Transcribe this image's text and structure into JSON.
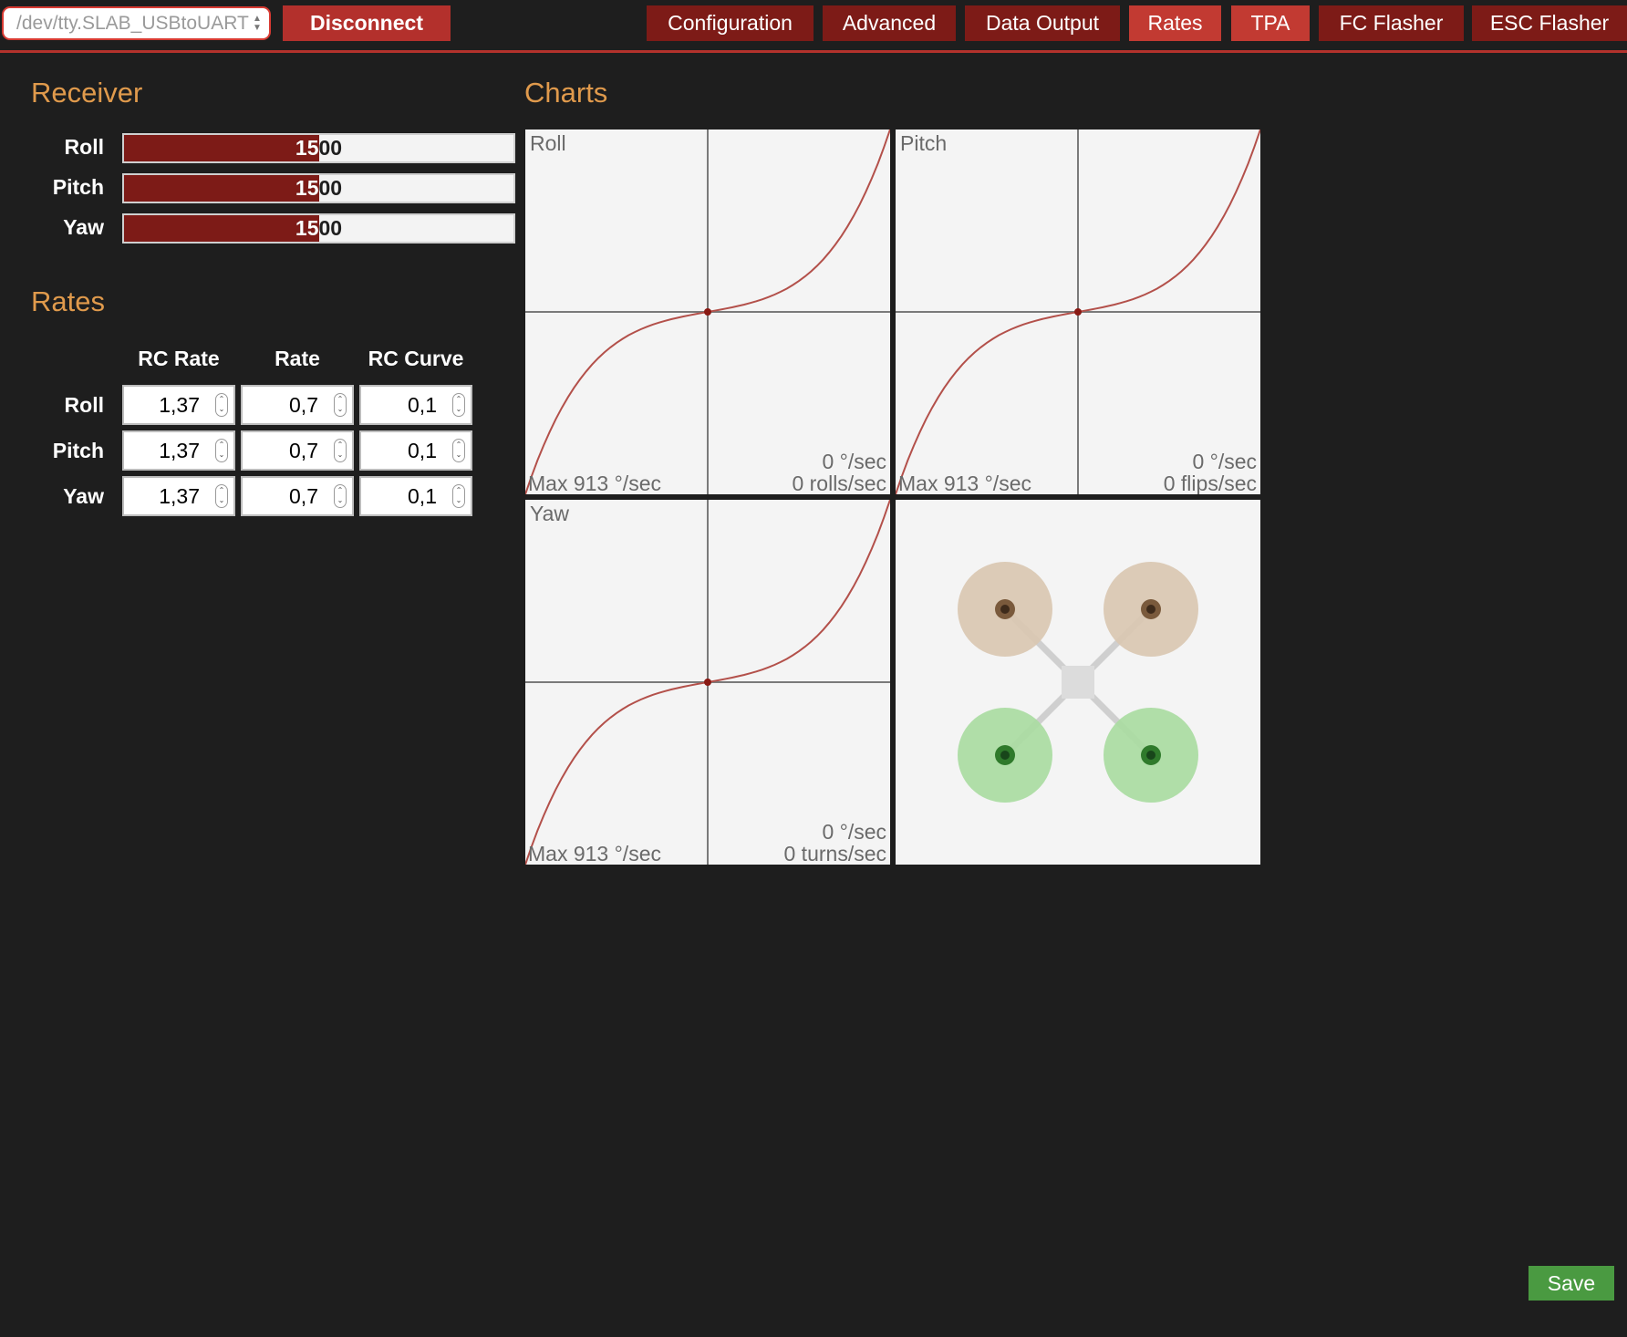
{
  "port": {
    "selected": "/dev/tty.SLAB_USBtoUART"
  },
  "toolbar": {
    "disconnect_label": "Disconnect"
  },
  "tabs": [
    {
      "label": "Configuration",
      "active": false
    },
    {
      "label": "Advanced",
      "active": false
    },
    {
      "label": "Data Output",
      "active": false
    },
    {
      "label": "Rates",
      "active": true
    },
    {
      "label": "TPA",
      "active": true
    },
    {
      "label": "FC Flasher",
      "active": false
    },
    {
      "label": "ESC Flasher",
      "active": false
    }
  ],
  "receiver": {
    "title": "Receiver",
    "channels": [
      {
        "label": "Roll",
        "value": "1500",
        "fill_fraction": 0.5
      },
      {
        "label": "Pitch",
        "value": "1500",
        "fill_fraction": 0.5
      },
      {
        "label": "Yaw",
        "value": "1500",
        "fill_fraction": 0.5
      }
    ]
  },
  "rates": {
    "title": "Rates",
    "columns": [
      "RC Rate",
      "Rate",
      "RC Curve"
    ],
    "rows": [
      {
        "label": "Roll",
        "rc_rate": "1,37",
        "rate": "0,7",
        "rc_curve": "0,1"
      },
      {
        "label": "Pitch",
        "rc_rate": "1,37",
        "rate": "0,7",
        "rc_curve": "0,1"
      },
      {
        "label": "Yaw",
        "rc_rate": "1,37",
        "rate": "0,7",
        "rc_curve": "0,1"
      }
    ]
  },
  "charts": {
    "title": "Charts",
    "panels": [
      {
        "title": "Roll",
        "max_label": "Max 913 °/sec",
        "rate_label": "0 °/sec",
        "unit_label": "0 rolls/sec"
      },
      {
        "title": "Pitch",
        "max_label": "Max 913 °/sec",
        "rate_label": "0 °/sec",
        "unit_label": "0 flips/sec"
      },
      {
        "title": "Yaw",
        "max_label": "Max 913 °/sec",
        "rate_label": "0 °/sec",
        "unit_label": "0 turns/sec"
      }
    ]
  },
  "colors": {
    "accent_heading": "#e09a4c",
    "tab_dark": "#7d1b17",
    "tab_active": "#c23a32",
    "curve": "#b3504a",
    "motor_front": "#d9c7b0",
    "motor_rear": "#a9dca0",
    "save": "#4a9a41"
  },
  "save_label": "Save"
}
